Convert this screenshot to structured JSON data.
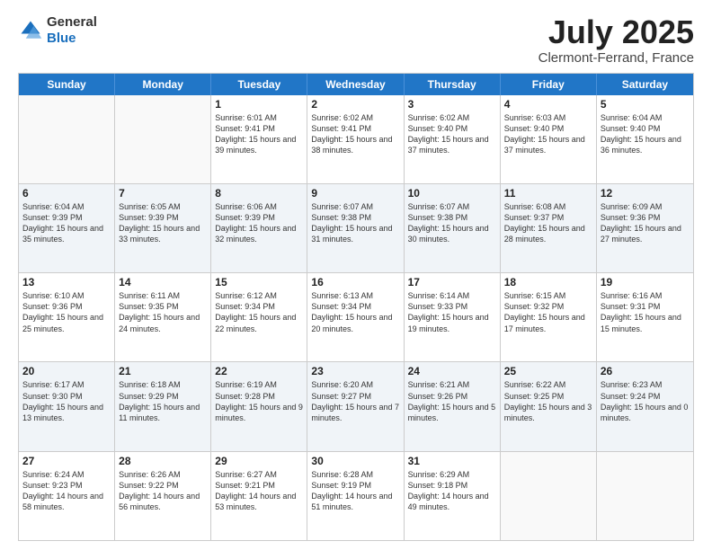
{
  "header": {
    "logo_general": "General",
    "logo_blue": "Blue",
    "month": "July 2025",
    "location": "Clermont-Ferrand, France"
  },
  "weekdays": [
    "Sunday",
    "Monday",
    "Tuesday",
    "Wednesday",
    "Thursday",
    "Friday",
    "Saturday"
  ],
  "rows": [
    [
      {
        "day": "",
        "text": "",
        "empty": true
      },
      {
        "day": "",
        "text": "",
        "empty": true
      },
      {
        "day": "1",
        "text": "Sunrise: 6:01 AM\nSunset: 9:41 PM\nDaylight: 15 hours and 39 minutes."
      },
      {
        "day": "2",
        "text": "Sunrise: 6:02 AM\nSunset: 9:41 PM\nDaylight: 15 hours and 38 minutes."
      },
      {
        "day": "3",
        "text": "Sunrise: 6:02 AM\nSunset: 9:40 PM\nDaylight: 15 hours and 37 minutes."
      },
      {
        "day": "4",
        "text": "Sunrise: 6:03 AM\nSunset: 9:40 PM\nDaylight: 15 hours and 37 minutes."
      },
      {
        "day": "5",
        "text": "Sunrise: 6:04 AM\nSunset: 9:40 PM\nDaylight: 15 hours and 36 minutes."
      }
    ],
    [
      {
        "day": "6",
        "text": "Sunrise: 6:04 AM\nSunset: 9:39 PM\nDaylight: 15 hours and 35 minutes."
      },
      {
        "day": "7",
        "text": "Sunrise: 6:05 AM\nSunset: 9:39 PM\nDaylight: 15 hours and 33 minutes."
      },
      {
        "day": "8",
        "text": "Sunrise: 6:06 AM\nSunset: 9:39 PM\nDaylight: 15 hours and 32 minutes."
      },
      {
        "day": "9",
        "text": "Sunrise: 6:07 AM\nSunset: 9:38 PM\nDaylight: 15 hours and 31 minutes."
      },
      {
        "day": "10",
        "text": "Sunrise: 6:07 AM\nSunset: 9:38 PM\nDaylight: 15 hours and 30 minutes."
      },
      {
        "day": "11",
        "text": "Sunrise: 6:08 AM\nSunset: 9:37 PM\nDaylight: 15 hours and 28 minutes."
      },
      {
        "day": "12",
        "text": "Sunrise: 6:09 AM\nSunset: 9:36 PM\nDaylight: 15 hours and 27 minutes."
      }
    ],
    [
      {
        "day": "13",
        "text": "Sunrise: 6:10 AM\nSunset: 9:36 PM\nDaylight: 15 hours and 25 minutes."
      },
      {
        "day": "14",
        "text": "Sunrise: 6:11 AM\nSunset: 9:35 PM\nDaylight: 15 hours and 24 minutes."
      },
      {
        "day": "15",
        "text": "Sunrise: 6:12 AM\nSunset: 9:34 PM\nDaylight: 15 hours and 22 minutes."
      },
      {
        "day": "16",
        "text": "Sunrise: 6:13 AM\nSunset: 9:34 PM\nDaylight: 15 hours and 20 minutes."
      },
      {
        "day": "17",
        "text": "Sunrise: 6:14 AM\nSunset: 9:33 PM\nDaylight: 15 hours and 19 minutes."
      },
      {
        "day": "18",
        "text": "Sunrise: 6:15 AM\nSunset: 9:32 PM\nDaylight: 15 hours and 17 minutes."
      },
      {
        "day": "19",
        "text": "Sunrise: 6:16 AM\nSunset: 9:31 PM\nDaylight: 15 hours and 15 minutes."
      }
    ],
    [
      {
        "day": "20",
        "text": "Sunrise: 6:17 AM\nSunset: 9:30 PM\nDaylight: 15 hours and 13 minutes."
      },
      {
        "day": "21",
        "text": "Sunrise: 6:18 AM\nSunset: 9:29 PM\nDaylight: 15 hours and 11 minutes."
      },
      {
        "day": "22",
        "text": "Sunrise: 6:19 AM\nSunset: 9:28 PM\nDaylight: 15 hours and 9 minutes."
      },
      {
        "day": "23",
        "text": "Sunrise: 6:20 AM\nSunset: 9:27 PM\nDaylight: 15 hours and 7 minutes."
      },
      {
        "day": "24",
        "text": "Sunrise: 6:21 AM\nSunset: 9:26 PM\nDaylight: 15 hours and 5 minutes."
      },
      {
        "day": "25",
        "text": "Sunrise: 6:22 AM\nSunset: 9:25 PM\nDaylight: 15 hours and 3 minutes."
      },
      {
        "day": "26",
        "text": "Sunrise: 6:23 AM\nSunset: 9:24 PM\nDaylight: 15 hours and 0 minutes."
      }
    ],
    [
      {
        "day": "27",
        "text": "Sunrise: 6:24 AM\nSunset: 9:23 PM\nDaylight: 14 hours and 58 minutes."
      },
      {
        "day": "28",
        "text": "Sunrise: 6:26 AM\nSunset: 9:22 PM\nDaylight: 14 hours and 56 minutes."
      },
      {
        "day": "29",
        "text": "Sunrise: 6:27 AM\nSunset: 9:21 PM\nDaylight: 14 hours and 53 minutes."
      },
      {
        "day": "30",
        "text": "Sunrise: 6:28 AM\nSunset: 9:19 PM\nDaylight: 14 hours and 51 minutes."
      },
      {
        "day": "31",
        "text": "Sunrise: 6:29 AM\nSunset: 9:18 PM\nDaylight: 14 hours and 49 minutes."
      },
      {
        "day": "",
        "text": "",
        "empty": true
      },
      {
        "day": "",
        "text": "",
        "empty": true
      }
    ]
  ]
}
